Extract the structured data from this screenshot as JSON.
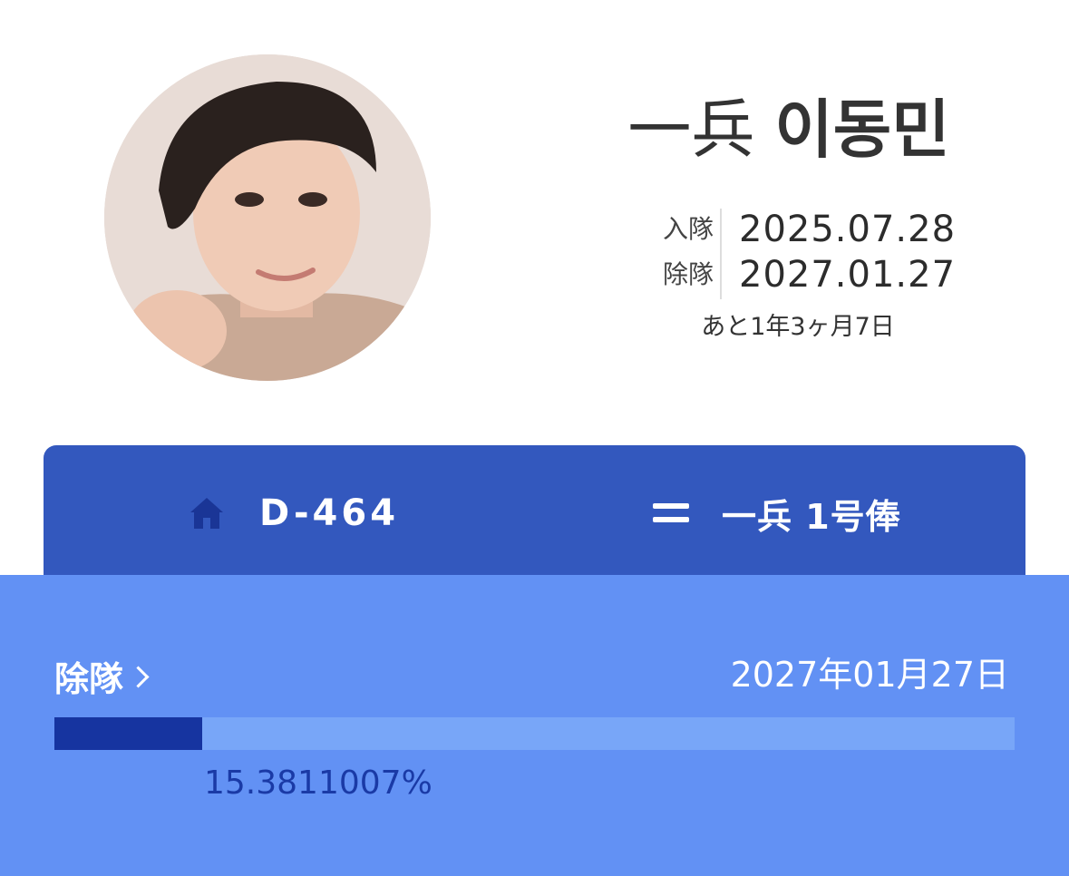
{
  "profile": {
    "avatar": "portrait photo",
    "rank": "一兵",
    "name": "이동민",
    "enlist_label": "入隊",
    "enlist_date": "2025.07.28",
    "discharge_label": "除隊",
    "discharge_date": "2027.01.27",
    "remaining": "あと1年3ヶ月7日"
  },
  "tabs": {
    "dday_icon": "home-icon",
    "dday": "D-464",
    "rank_icon": "equals-icon",
    "rank": "一兵 1号俸"
  },
  "progress": {
    "label": "除隊",
    "end_date": "2027年01月27日",
    "percent_text": "15.3811007%",
    "fraction": 0.153811007
  },
  "colors": {
    "tab_bar": "#3358be",
    "panel": "#6291f4",
    "track": "#78a6f8",
    "fill": "#1634a0"
  }
}
